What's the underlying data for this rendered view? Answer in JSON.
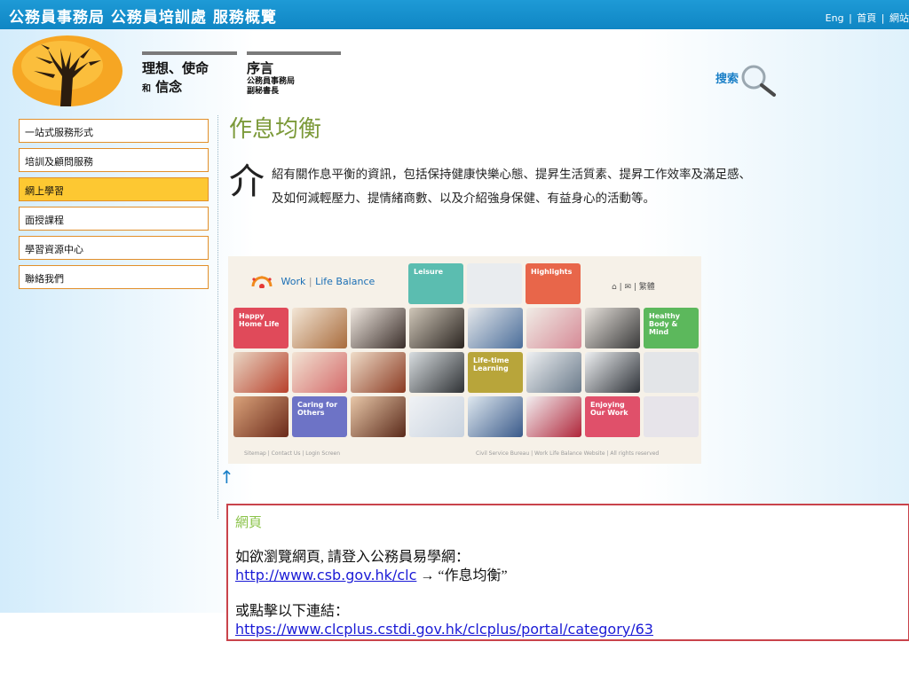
{
  "header": {
    "title": "公務員事務局 公務員培訓處 服務概覽",
    "links": [
      "Eng",
      "|",
      "首頁",
      "|",
      "網站"
    ]
  },
  "nav": {
    "tab1": {
      "line1": "理想、使命",
      "prefix": "和",
      "line2": "信念"
    },
    "tab2": {
      "title": "序言",
      "sub1": "公務員事務局",
      "sub2": "副秘書長"
    }
  },
  "search": {
    "label": "搜索",
    "icon": "magnifier-icon"
  },
  "menu": [
    {
      "label": "一站式服務形式",
      "active": false
    },
    {
      "label": "培訓及顧問服務",
      "active": false
    },
    {
      "label": "網上學習",
      "active": true
    },
    {
      "label": "面授課程",
      "active": false
    },
    {
      "label": "學習資源中心",
      "active": false
    },
    {
      "label": "聯絡我們",
      "active": false
    }
  ],
  "main": {
    "heading": "作息均衡",
    "dropcap": "介",
    "intro": "紹有關作息平衡的資訊，包括保持健康快樂心態、提昇生活質素、提昇工作效率及滿足感、及如何減輕壓力、提情緒商數、以及介紹強身保健、有益身心的活動等。"
  },
  "screenshot": {
    "brand_work": "Work",
    "brand_rest": "Life Balance",
    "tool_icons": "⌂ | ✉ | 繁體",
    "tiles": [
      {
        "label": "Leisure",
        "color": "#5bbdb0"
      },
      {
        "label": "Highlights",
        "color": "#e8664a"
      },
      {
        "label": "Happy Home Life",
        "color": "#e04a5a"
      },
      {
        "label": "Healthy Body & Mind",
        "color": "#5cb85c"
      },
      {
        "label": "Life-time Learning",
        "color": "#b8a53a"
      },
      {
        "label": "Caring for Others",
        "color": "#6d73c6"
      },
      {
        "label": "Enjoying Our Work",
        "color": "#e0506a"
      }
    ],
    "footer_left": "Sitemap | Contact Us | Login Screen",
    "footer_right": "Civil Service Bureau | Work Life Balance Website | All rights reserved"
  },
  "back_to_top": "↑",
  "info": {
    "title": "網頁",
    "line1": "如欲瀏覽網頁, 請登入公務員易學網：",
    "link1": "http://www.csb.gov.hk/clc",
    "arrow_text": " → “作息均衡”",
    "line2": "或點擊以下連結：",
    "link2": "https://www.clcplus.cstdi.gov.hk/clcplus/portal/category/63"
  }
}
